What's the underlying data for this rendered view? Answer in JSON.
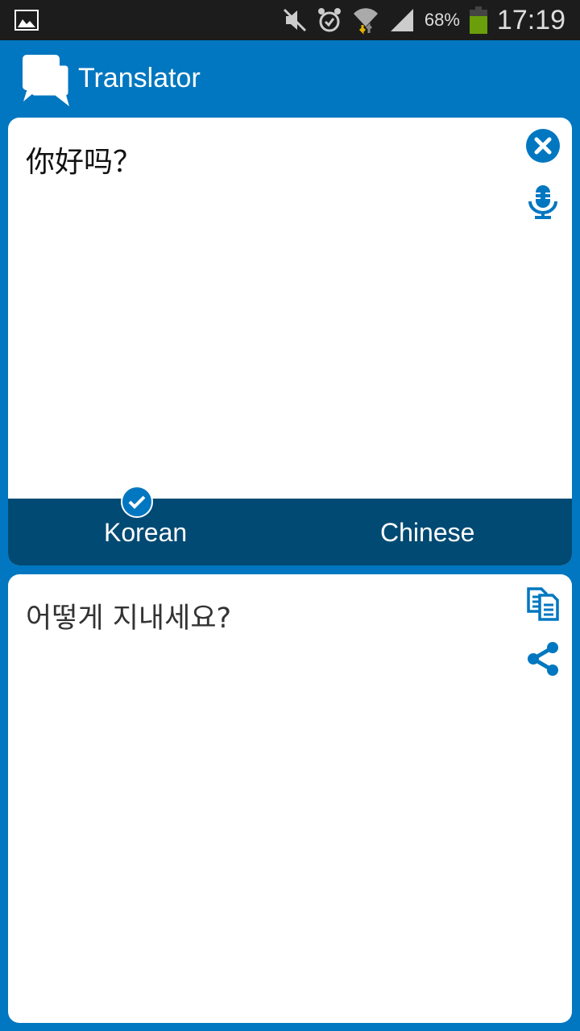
{
  "status_bar": {
    "battery": "68%",
    "time": "17:19",
    "icons": [
      "gallery-icon",
      "mute-icon",
      "alarm-icon",
      "wifi-icon",
      "signal-icon",
      "battery-icon"
    ]
  },
  "app_bar": {
    "title": "Translator",
    "icon": "chat-bubbles-icon"
  },
  "source": {
    "text": "你好吗？",
    "icons": [
      "clear-icon",
      "microphone-icon"
    ]
  },
  "languages": {
    "left": "Korean",
    "right": "Chinese",
    "selected": "Korean"
  },
  "result": {
    "text": "어떻게 지내세요?",
    "icons": [
      "copy-icon",
      "share-icon"
    ]
  },
  "colors": {
    "accent": "#0077c0",
    "lang_bar": "#004a73",
    "status_bar": "#1c1c1c",
    "battery": "#6a9e0a"
  }
}
